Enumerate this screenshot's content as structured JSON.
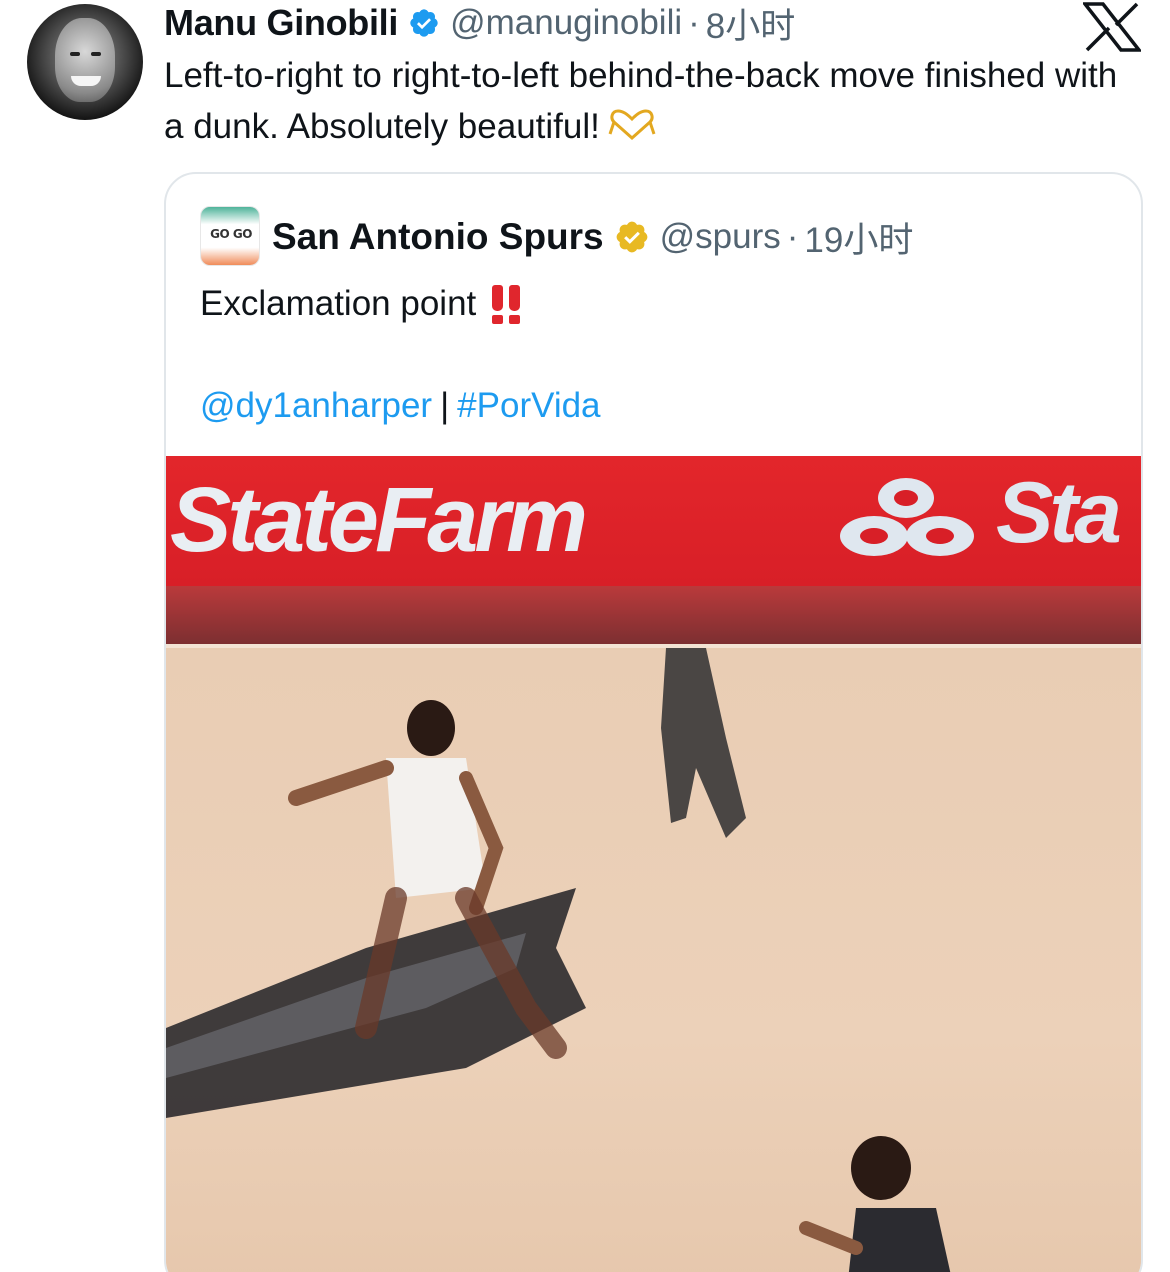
{
  "tweet": {
    "display_name": "Manu Ginobili",
    "handle": "@manuginobili",
    "separator": "·",
    "time": "8小时",
    "text": "Left-to-right to right-to-left behind-the-back move finished with a dunk. Absolutely beautiful!",
    "emoji": "heart-hands-icon",
    "verified_color": "#1d9bf0"
  },
  "quoted_tweet": {
    "display_name": "San Antonio Spurs",
    "handle": "@spurs",
    "separator": "·",
    "time": "19小时",
    "text": "Exclamation point",
    "emoji": "double-exclamation-icon",
    "mention": "@dy1anharper",
    "link_separator": "|",
    "hashtag": "#PorVida",
    "verified_color": "#e8b923",
    "avatar_logo_text": "GO GO"
  },
  "media": {
    "banner_text": "StateFarm",
    "banner_text_right": "Sta"
  },
  "colors": {
    "link": "#1d9bf0",
    "secondary_text": "#536471",
    "banner_red": "#e3262b"
  }
}
